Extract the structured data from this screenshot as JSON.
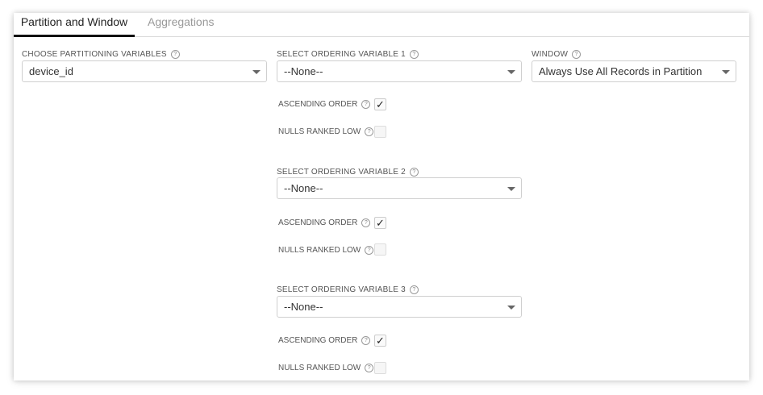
{
  "tabs": [
    {
      "label": "Partition and Window",
      "active": true
    },
    {
      "label": "Aggregations",
      "active": false
    }
  ],
  "partition": {
    "label": "CHOOSE PARTITIONING VARIABLES",
    "value": "device_id"
  },
  "window": {
    "label": "WINDOW",
    "value": "Always Use All Records in Partition"
  },
  "ordering": [
    {
      "label": "SELECT ORDERING VARIABLE 1",
      "value": "--None--",
      "ascending_label": "ASCENDING ORDER",
      "ascending_checked": true,
      "nulls_label": "NULLS RANKED LOW",
      "nulls_checked": false
    },
    {
      "label": "SELECT ORDERING VARIABLE 2",
      "value": "--None--",
      "ascending_label": "ASCENDING ORDER",
      "ascending_checked": true,
      "nulls_label": "NULLS RANKED LOW",
      "nulls_checked": false
    },
    {
      "label": "SELECT ORDERING VARIABLE 3",
      "value": "--None--",
      "ascending_label": "ASCENDING ORDER",
      "ascending_checked": true,
      "nulls_label": "NULLS RANKED LOW",
      "nulls_checked": false
    }
  ],
  "icons": {
    "help": "question-circle-icon",
    "caret": "chevron-down-icon",
    "check": "checkmark-icon"
  },
  "glyphs": {
    "help": "?",
    "check": "✓"
  }
}
